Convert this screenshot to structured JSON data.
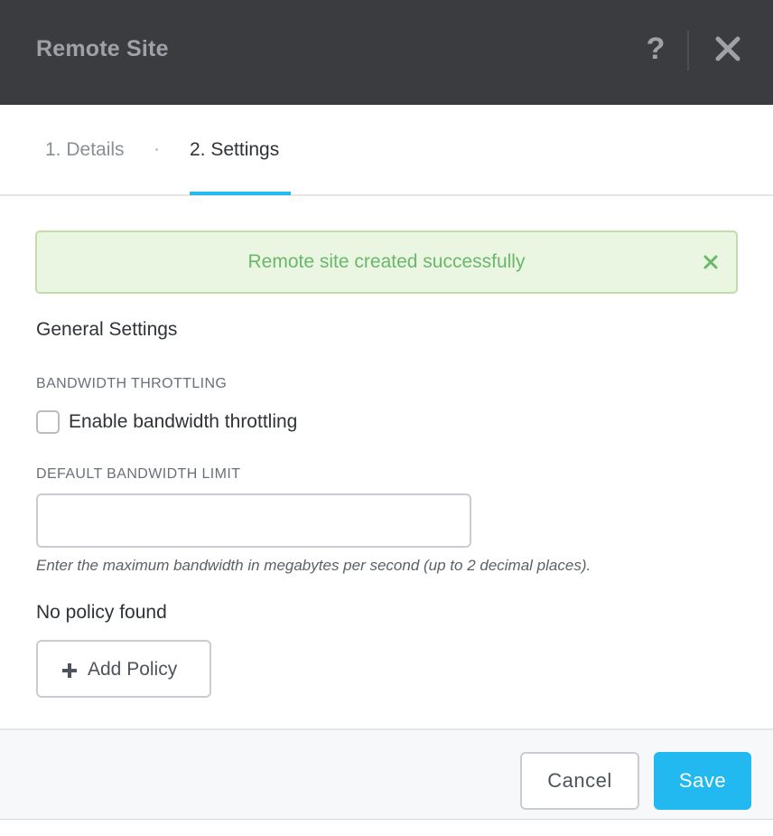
{
  "header": {
    "title": "Remote Site",
    "help_icon": "question-mark-icon",
    "close_icon": "close-x-icon"
  },
  "tabs": [
    {
      "label": "1. Details",
      "active": false
    },
    {
      "label": "2. Settings",
      "active": true
    }
  ],
  "alert": {
    "message": "Remote site created successfully",
    "type": "success",
    "close_icon": "close-x-icon"
  },
  "general_settings": {
    "title": "General Settings",
    "bandwidth_throttling": {
      "label": "BANDWIDTH THROTTLING",
      "checkbox_label": "Enable bandwidth throttling",
      "checked": false
    },
    "default_bandwidth_limit": {
      "label": "DEFAULT BANDWIDTH LIMIT",
      "value": "",
      "help": "Enter the maximum bandwidth in megabytes per second (up to 2 decimal places)."
    }
  },
  "policy": {
    "empty_text": "No policy found",
    "add_button": "Add Policy",
    "add_icon": "plus-icon"
  },
  "footer": {
    "cancel_label": "Cancel",
    "save_label": "Save"
  },
  "colors": {
    "header_bg": "#3a3c3f",
    "accent": "#22b8f0",
    "success_bg": "#eaf5e2",
    "success_text": "#6ab86a"
  }
}
